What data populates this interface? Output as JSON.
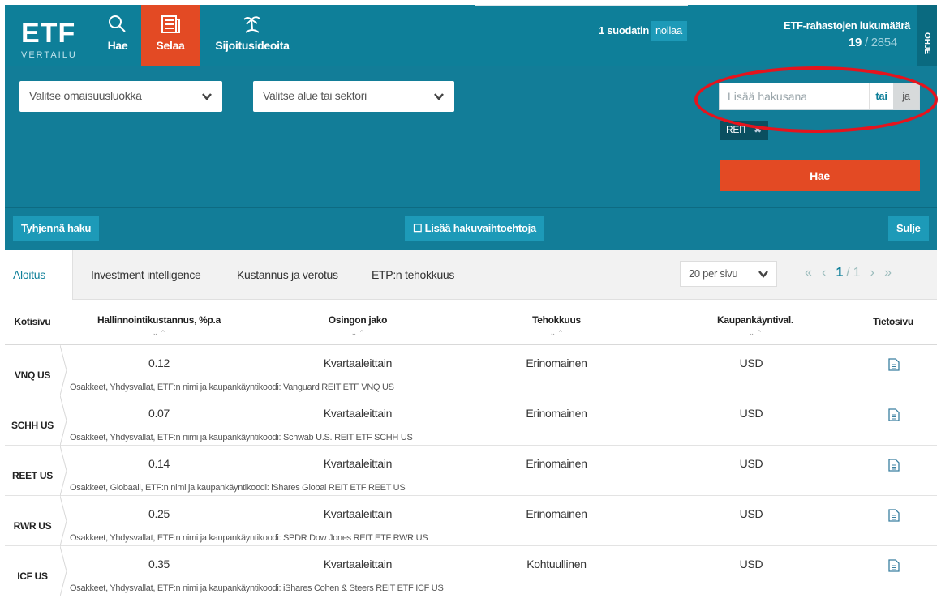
{
  "header": {
    "logo_text": "ETF",
    "logo_sub": "VERTAILU",
    "nav": [
      {
        "label": "Hae"
      },
      {
        "label": "Selaa"
      },
      {
        "label": "Sijoitusideoita"
      }
    ],
    "filter_count": "1 suodatin",
    "reset_label": "nollaa",
    "count_label": "ETF-rahastojen lukumäärä",
    "count_current": "19",
    "count_total": "/ 2854",
    "help_label": "OHJE"
  },
  "filters": {
    "asset_class_placeholder": "Valitse omaisuusluokka",
    "region_placeholder": "Valitse alue tai sektori",
    "search_placeholder": "Lisää hakusana",
    "or_label": "tai",
    "and_label": "ja",
    "tag": "REIT",
    "search_button": "Hae"
  },
  "actions": {
    "clear": "Tyhjennä haku",
    "more_options": "☐ Lisää hakuvaihtoehtoja",
    "close": "Sulje"
  },
  "tabs": {
    "items": [
      {
        "label": "Aloitus"
      },
      {
        "label": "Investment intelligence"
      },
      {
        "label": "Kustannus ja verotus"
      },
      {
        "label": "ETP:n tehokkuus"
      }
    ],
    "per_page": "20 per sivu",
    "page_current": "1",
    "page_total": "/ 1"
  },
  "table": {
    "columns": [
      "Kotisivu",
      "Hallinnointikustannus, %p.a",
      "Osingon jako",
      "Tehokkuus",
      "Kaupankäyntival.",
      "Tietosivu"
    ],
    "sort_indicator": "⌄ ⌃",
    "rows": [
      {
        "ticker": "VNQ US",
        "fee": "0.12",
        "dividend": "Kvartaaleittain",
        "efficiency": "Erinomainen",
        "currency": "USD",
        "desc": "Osakkeet, Yhdysvallat, ETF:n nimi ja kaupankäyntikoodi: Vanguard REIT ETF VNQ US"
      },
      {
        "ticker": "SCHH US",
        "fee": "0.07",
        "dividend": "Kvartaaleittain",
        "efficiency": "Erinomainen",
        "currency": "USD",
        "desc": "Osakkeet, Yhdysvallat, ETF:n nimi ja kaupankäyntikoodi: Schwab U.S. REIT ETF SCHH US"
      },
      {
        "ticker": "REET US",
        "fee": "0.14",
        "dividend": "Kvartaaleittain",
        "efficiency": "Erinomainen",
        "currency": "USD",
        "desc": "Osakkeet, Globaali, ETF:n nimi ja kaupankäyntikoodi: iShares Global REIT ETF REET US"
      },
      {
        "ticker": "RWR US",
        "fee": "0.25",
        "dividend": "Kvartaaleittain",
        "efficiency": "Erinomainen",
        "currency": "USD",
        "desc": "Osakkeet, Yhdysvallat, ETF:n nimi ja kaupankäyntikoodi: SPDR Dow Jones REIT ETF RWR US"
      },
      {
        "ticker": "ICF US",
        "fee": "0.35",
        "dividend": "Kvartaaleittain",
        "efficiency": "Kohtuullinen",
        "currency": "USD",
        "desc": "Osakkeet, Yhdysvallat, ETF:n nimi ja kaupankäyntikoodi: iShares Cohen & Steers REIT ETF ICF US"
      }
    ]
  },
  "colors": {
    "primary": "#0e7f99",
    "accent": "#e34a24",
    "highlight_ring": "#e5141d"
  }
}
